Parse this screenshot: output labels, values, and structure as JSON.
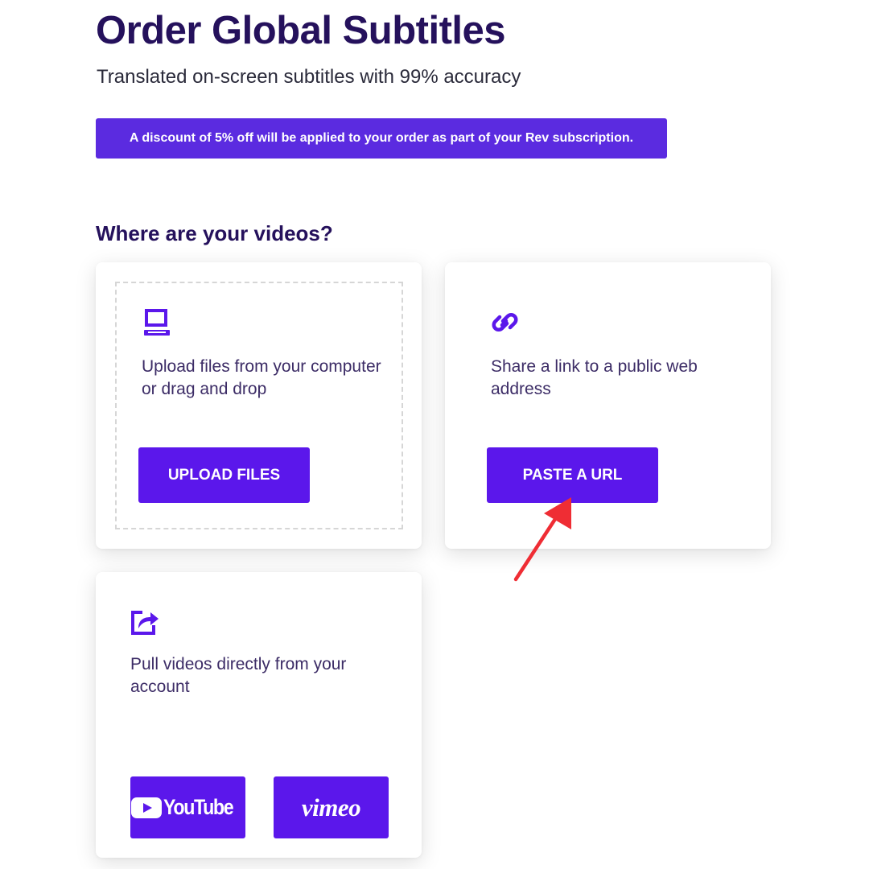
{
  "page": {
    "title": "Order Global Subtitles",
    "subtitle": "Translated on-screen subtitles with 99% accuracy",
    "discount_banner": "A discount of 5% off will be applied to your order as part of your Rev subscription."
  },
  "section": {
    "heading": "Where are your videos?"
  },
  "cards": {
    "upload": {
      "icon": "laptop-icon",
      "text": "Upload files from your computer or drag and drop",
      "button_label": "UPLOAD FILES"
    },
    "url": {
      "icon": "link-icon",
      "text": "Share a link to a public web address",
      "button_label": "PASTE A URL"
    },
    "pull": {
      "icon": "share-export-icon",
      "text": "Pull videos directly from your account",
      "youtube_label": "YouTube",
      "vimeo_label": "vimeo"
    }
  },
  "annotation": {
    "icon": "red-arrow-icon",
    "color": "#ef2d34"
  },
  "colors": {
    "brand_purple": "#5b17eb",
    "heading_navy": "#25115c",
    "banner_purple": "#5b2be0"
  }
}
